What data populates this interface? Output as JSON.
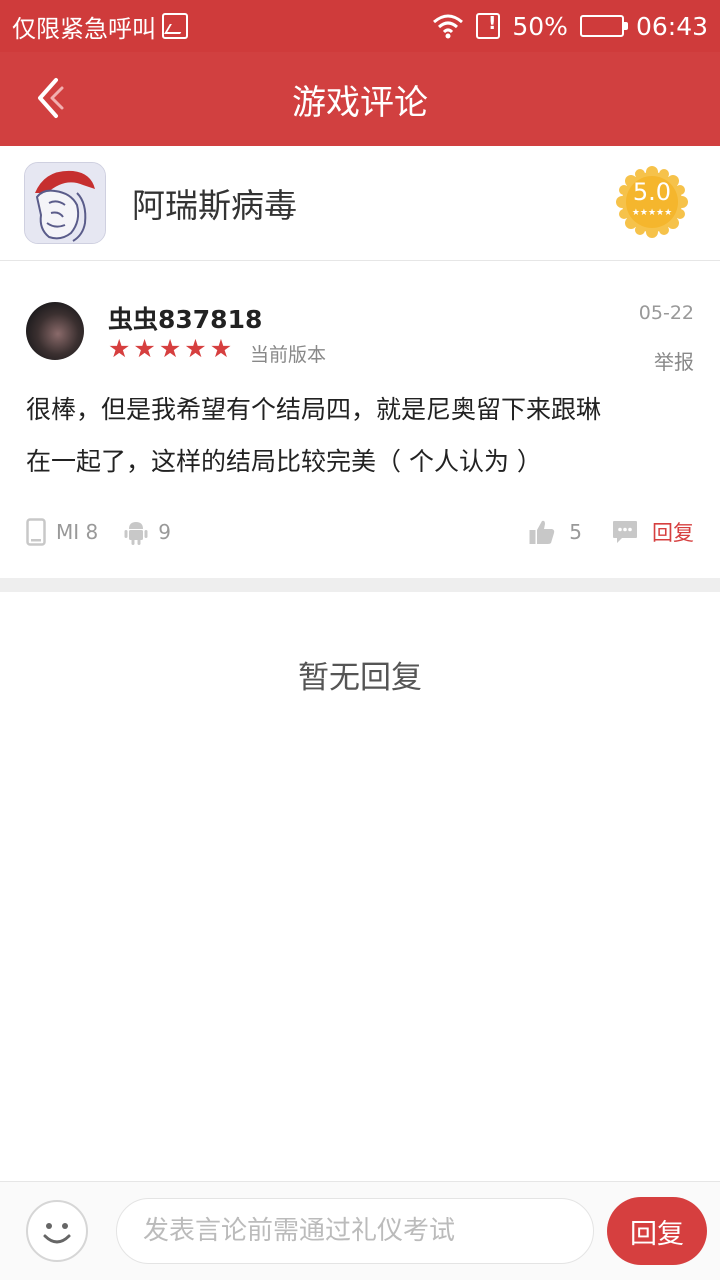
{
  "status_bar": {
    "carrier_text": "仅限紧急呼叫",
    "battery_percent": "50%",
    "battery_level": 0.5,
    "time": "06:43",
    "icons": [
      "image-icon",
      "wifi-icon",
      "sim-alert-icon",
      "battery-icon"
    ]
  },
  "header": {
    "title": "游戏评论",
    "back_icon": "back-arrow-icon"
  },
  "game": {
    "name": "阿瑞斯病毒",
    "score": "5.0",
    "score_stars": "★★★★★"
  },
  "comment": {
    "username": "虫虫837818",
    "rating": 5,
    "version_label": "当前版本",
    "date": "05-22",
    "report_label": "举报",
    "text_line1": "很棒，但是我希望有个结局四，就是尼奥留下来跟琳",
    "text_line2": "在一起了，这样的结局比较完美（ 个人认为 ）",
    "device": "MI 8",
    "android_version": "9",
    "likes": "5",
    "reply_label": "回复"
  },
  "empty_state": {
    "text": "暂无回复"
  },
  "bottom_bar": {
    "input_placeholder": "发表言论前需通过礼仪考试",
    "reply_button": "回复"
  },
  "colors": {
    "primary_red": "#d14040",
    "status_bar_red": "#cf3b3b",
    "star_red": "#d63f3f",
    "badge_gold": "#f6c24a"
  }
}
